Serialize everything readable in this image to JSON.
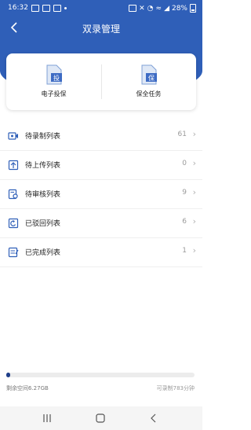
{
  "status_bar": {
    "time": "16:32",
    "battery": "28%"
  },
  "header": {
    "title": "双录管理",
    "back_icon": "chevron-left-icon"
  },
  "colors": {
    "primary": "#2f5fb8",
    "progress": "#1f3f8a"
  },
  "quick_actions": [
    {
      "label": "电子投保",
      "icon": "document-icon",
      "badge": "投"
    },
    {
      "label": "保全任务",
      "icon": "document-icon",
      "badge": "保"
    }
  ],
  "lists": [
    {
      "label": "待录制列表",
      "count": "61",
      "icon": "video-recorder-icon"
    },
    {
      "label": "待上传列表",
      "count": "0",
      "icon": "upload-icon"
    },
    {
      "label": "待审核列表",
      "count": "9",
      "icon": "review-icon"
    },
    {
      "label": "已驳回列表",
      "count": "6",
      "icon": "rejected-icon"
    },
    {
      "label": "已完成列表",
      "count": "1",
      "icon": "completed-icon"
    }
  ],
  "storage": {
    "remaining_label": "剩余空间6.27GB",
    "recordable_label": "可录制783分钟",
    "used_fraction": 0.02
  }
}
